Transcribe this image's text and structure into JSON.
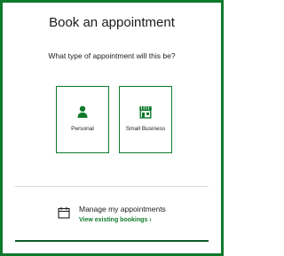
{
  "page": {
    "title": "Book an appointment",
    "question": "What type of appointment will this be?"
  },
  "options": [
    {
      "label": "Personal",
      "icon": "person-icon"
    },
    {
      "label": "Small Business",
      "icon": "storefront-icon"
    }
  ],
  "manage": {
    "title": "Manage my appointments",
    "link_label": "View existing bookings ›",
    "icon": "calendar-icon"
  },
  "colors": {
    "accent": "#0f7a2b",
    "frame": "#0f7a2b",
    "text": "#1b1b1b",
    "divider": "#d8d8d8"
  }
}
